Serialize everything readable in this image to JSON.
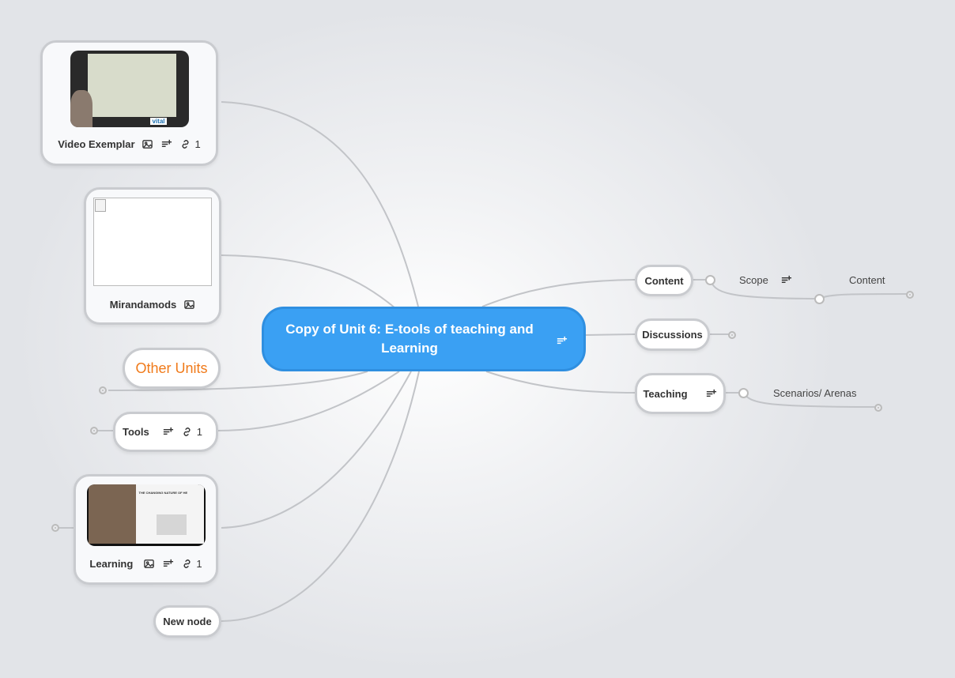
{
  "center": {
    "title": "Copy of Unit 6: E-tools of teaching and Learning"
  },
  "left_nodes": {
    "video_exemplar": {
      "label": "Video Exemplar",
      "link_count": "1",
      "thumb_text": "vital"
    },
    "mirandamods": {
      "label": "Mirandamods"
    },
    "other_units": {
      "label": "Other Units",
      "color": "#f07a1a"
    },
    "tools": {
      "label": "Tools",
      "link_count": "1"
    },
    "learning": {
      "label": "Learning",
      "link_count": "1",
      "thumb_text": "THE CHANGING NATURE OF HE"
    },
    "new_node": {
      "label": "New node"
    }
  },
  "right_nodes": {
    "content": {
      "label": "Content",
      "child": "Scope",
      "grandchild": "Content"
    },
    "discussions": {
      "label": "Discussions"
    },
    "teaching": {
      "label": "Teaching",
      "child": "Scenarios/ Arenas"
    }
  },
  "colors": {
    "center_fill": "#3aa0f3",
    "link_stroke": "#c2c4c8",
    "node_border": "#c9cbcf"
  },
  "icons": [
    "image-icon",
    "notes-icon",
    "link-icon"
  ]
}
